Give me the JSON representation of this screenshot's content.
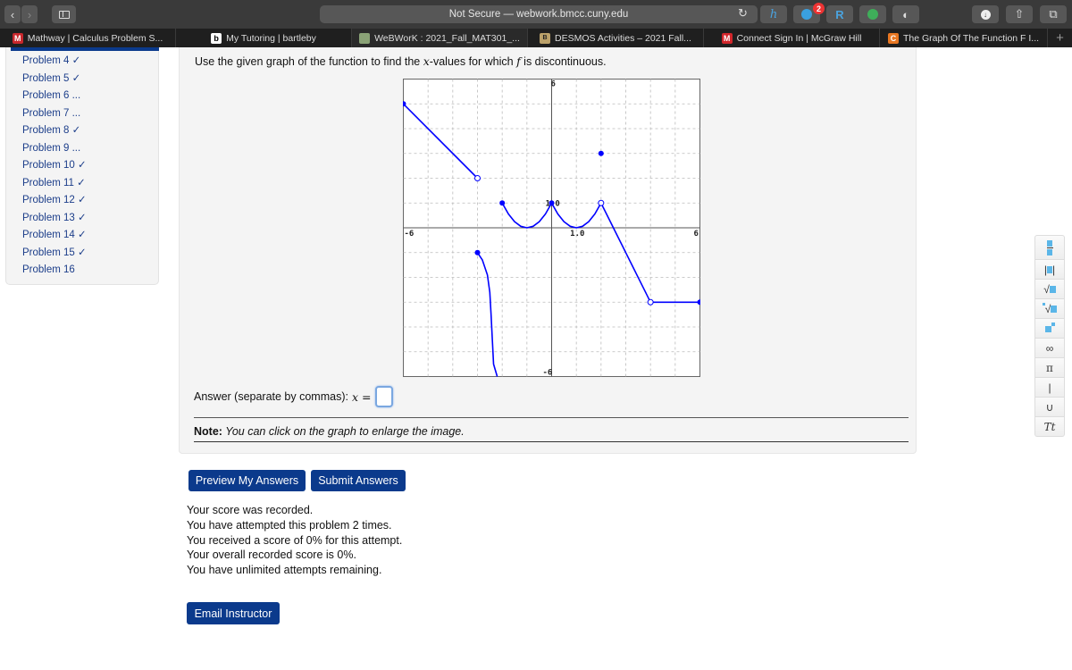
{
  "browser": {
    "address": "Not Secure — webwork.bmcc.cuny.edu",
    "extension_badge_count": "2",
    "tabs": [
      {
        "label": "Mathway | Calculus Problem S...",
        "icon": "mathway-icon"
      },
      {
        "label": "My Tutoring | bartleby",
        "icon": "bartleby-icon"
      },
      {
        "label": "WeBWorK : 2021_Fall_MAT301_...",
        "icon": "webwork-icon"
      },
      {
        "label": "DESMOS Activities – 2021 Fall...",
        "icon": "desmos-icon"
      },
      {
        "label": "Connect Sign In | McGraw Hill",
        "icon": "mcgraw-icon"
      },
      {
        "label": "The Graph Of The Function F I...",
        "icon": "chegg-icon"
      }
    ],
    "new_tab": "+"
  },
  "sidebar": {
    "problems": [
      "Problem 4 ✓",
      "Problem 5 ✓",
      "Problem 6 ...",
      "Problem 7 ...",
      "Problem 8 ✓",
      "Problem 9 ...",
      "Problem 10 ✓",
      "Problem 11 ✓",
      "Problem 12 ✓",
      "Problem 13 ✓",
      "Problem 14 ✓",
      "Problem 15 ✓",
      "Problem 16"
    ]
  },
  "problem": {
    "question_pre": "Use the given graph of the function to find the ",
    "question_var": "x",
    "question_mid": "-values for which ",
    "question_fn": "f",
    "question_post": " is discontinuous.",
    "answer_label": "Answer (separate by commas): ",
    "answer_var": "x",
    "answer_eq": " =",
    "answer_value": "",
    "note_bold": "Note:",
    "note_text": " You can click on the graph to enlarge the image."
  },
  "buttons": {
    "preview": "Preview My Answers",
    "submit": "Submit Answers",
    "email": "Email Instructor"
  },
  "status": [
    "Your score was recorded.",
    "You have attempted this problem 2 times.",
    "You received a score of 0% for this attempt.",
    "Your overall recorded score is 0%.",
    "You have unlimited attempts remaining."
  ],
  "math_palette": [
    "fraction",
    "absolute-value",
    "sqrt",
    "nth-root",
    "exponent",
    "∞",
    "π",
    "|",
    "∪",
    "Tt"
  ],
  "chart_data": {
    "type": "line",
    "title": "",
    "xlim": [
      -6,
      6
    ],
    "ylim": [
      -6,
      6
    ],
    "grid": true,
    "grid_step": 1,
    "tick_labels": {
      "x_min": "-6",
      "x_max": "6",
      "y_min": "-6",
      "y_max": "6",
      "x_unit": "1.0",
      "y_unit": "1.0"
    },
    "line_color": "#0000ff",
    "pieces": [
      {
        "kind": "line",
        "points": [
          [
            -6,
            5
          ],
          [
            -3,
            2
          ]
        ]
      },
      {
        "kind": "curve",
        "points": [
          [
            -3,
            -1
          ],
          [
            -2.8,
            -1.3
          ],
          [
            -2.6,
            -1.9
          ],
          [
            -2.5,
            -2.6
          ],
          [
            -2.45,
            -3.5
          ],
          [
            -2.4,
            -4.5
          ],
          [
            -2.35,
            -5.5
          ],
          [
            -2.2,
            -6
          ]
        ]
      },
      {
        "kind": "curve",
        "points": [
          [
            -2,
            1
          ],
          [
            -1.75,
            0.56
          ],
          [
            -1.5,
            0.25
          ],
          [
            -1.25,
            0.06
          ],
          [
            -1,
            0
          ],
          [
            -0.75,
            0.06
          ],
          [
            -0.5,
            0.25
          ],
          [
            -0.25,
            0.56
          ],
          [
            0,
            1
          ]
        ]
      },
      {
        "kind": "curve",
        "points": [
          [
            0,
            1
          ],
          [
            0.25,
            0.56
          ],
          [
            0.5,
            0.25
          ],
          [
            0.75,
            0.06
          ],
          [
            1,
            0
          ],
          [
            1.25,
            0.06
          ],
          [
            1.5,
            0.25
          ],
          [
            1.75,
            0.56
          ],
          [
            2,
            1
          ]
        ]
      },
      {
        "kind": "line",
        "points": [
          [
            2,
            1
          ],
          [
            4,
            -3
          ]
        ]
      },
      {
        "kind": "line",
        "points": [
          [
            4,
            -3
          ],
          [
            6,
            -3
          ]
        ]
      }
    ],
    "filled_points": [
      [
        -6,
        5
      ],
      [
        -3,
        -1
      ],
      [
        -2,
        1
      ],
      [
        0,
        1
      ],
      [
        2,
        3
      ],
      [
        6,
        -3
      ]
    ],
    "open_points": [
      [
        -3,
        2
      ],
      [
        2,
        1
      ],
      [
        4,
        -3
      ]
    ]
  }
}
